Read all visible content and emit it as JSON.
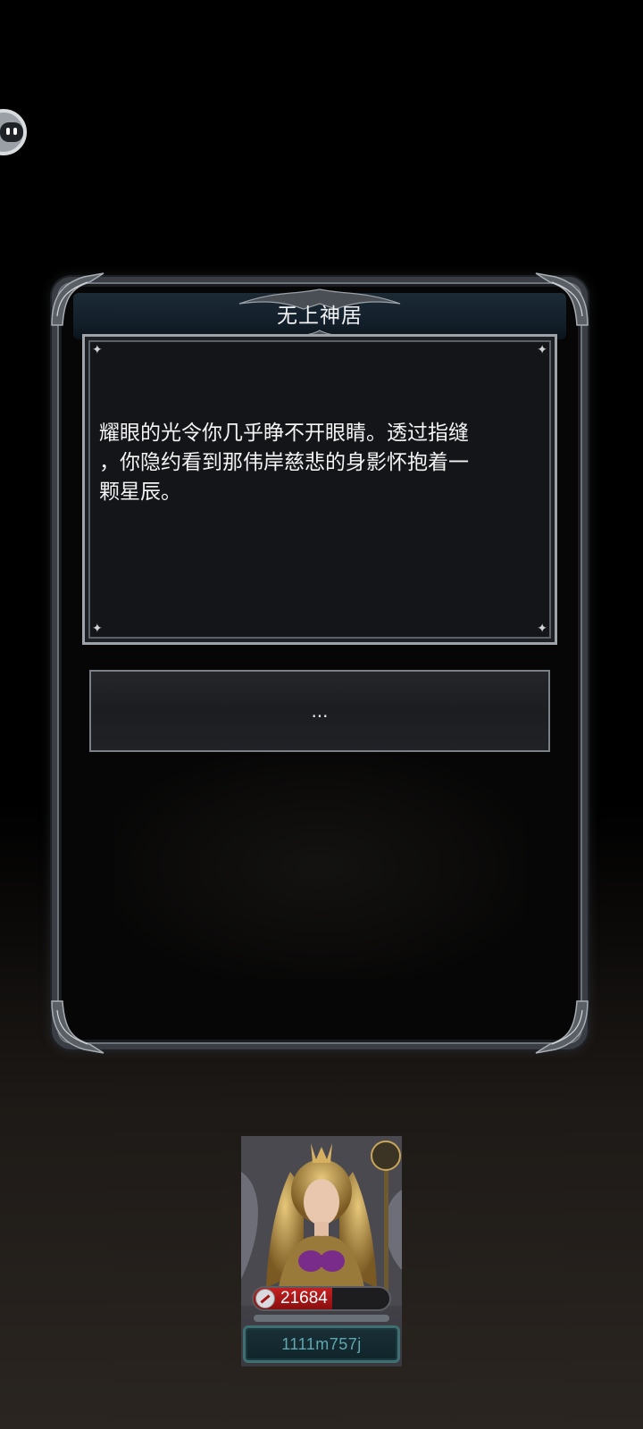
{
  "dialog": {
    "title": "无上神居",
    "story_text": "耀眼的光令你几乎睁不开眼睛。透过指缝\n，你隐约看到那伟岸慈悲的身影怀抱着一\n颗星辰。",
    "choice_label": "..."
  },
  "hero_card": {
    "power": "21684",
    "power_fill_fraction": 0.58,
    "player_name": "1111m757j"
  },
  "icons": {
    "floating_button": "assistant-bubble-icon",
    "power": "sword-power-icon"
  },
  "colors": {
    "title_bar": "#13202b",
    "panel_border": "#9ea3a9",
    "power_fill": "#c42021",
    "name_plate_text": "#5fa8b0"
  }
}
